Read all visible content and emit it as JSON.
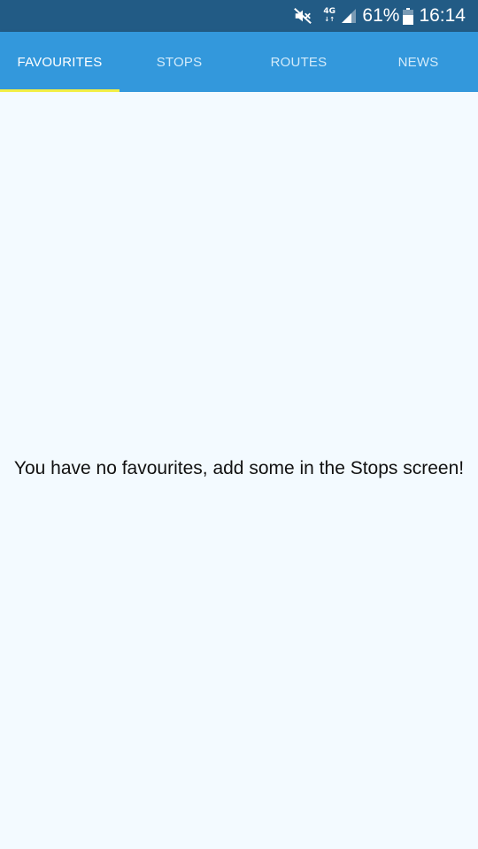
{
  "status_bar": {
    "network_type": "4G",
    "battery_percent": "61%",
    "time": "16:14",
    "icons": [
      "mute-icon",
      "signal-icon",
      "battery-icon"
    ]
  },
  "tabs": [
    {
      "label": "FAVOURITES",
      "active": true
    },
    {
      "label": "STOPS",
      "active": false
    },
    {
      "label": "ROUTES",
      "active": false
    },
    {
      "label": "NEWS",
      "active": false
    }
  ],
  "content": {
    "empty_message": "You have no favourites, add some in the Stops screen!"
  },
  "colors": {
    "status_bar": "#225b85",
    "tab_bar": "#3398dc",
    "active_indicator": "#f2ee45",
    "background": "#f3faff"
  }
}
